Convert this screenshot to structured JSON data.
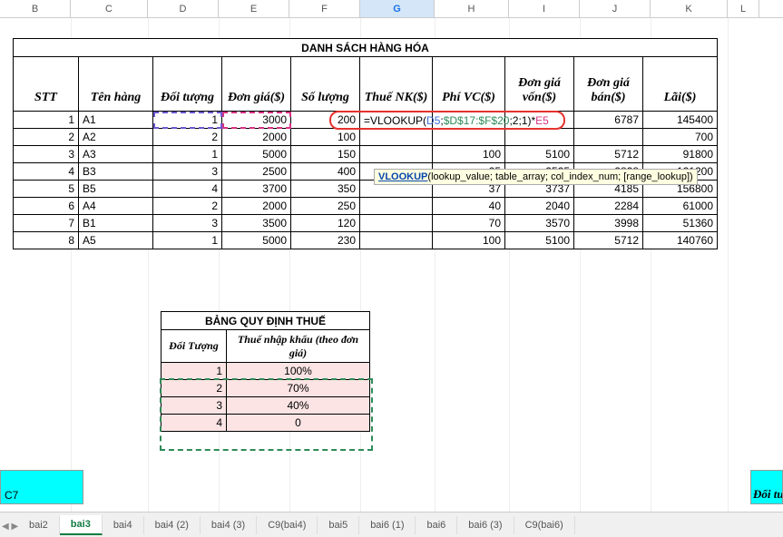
{
  "columns": [
    "B",
    "C",
    "D",
    "E",
    "F",
    "G",
    "H",
    "I",
    "J",
    "K",
    "L"
  ],
  "active_column": "G",
  "main": {
    "title": "DANH SÁCH HÀNG HÓA",
    "headers": [
      "STT",
      "Tên hàng",
      "Đối tượng",
      "Đơn giá($)",
      "Số lượng",
      "Thuế NK($)",
      "Phí VC($)",
      "Đơn giá vốn($)",
      "Đơn giá bán($)",
      "Lãi($)"
    ],
    "rows": [
      {
        "stt": "1",
        "ten": "A1",
        "dt": "1",
        "gia": "3000",
        "sl": "200",
        "thue": "=VLOOKUP(D5;$D$17:$F$20;2;1)*E5",
        "phi": "",
        "von": "",
        "ban": "6787",
        "lai": "145400"
      },
      {
        "stt": "2",
        "ten": "A2",
        "dt": "2",
        "gia": "2000",
        "sl": "100",
        "thue": "",
        "phi": "",
        "von": "",
        "ban": "",
        "lai": "700"
      },
      {
        "stt": "3",
        "ten": "A3",
        "dt": "1",
        "gia": "5000",
        "sl": "150",
        "thue": "",
        "phi": "100",
        "von": "5100",
        "ban": "5712",
        "lai": "91800"
      },
      {
        "stt": "4",
        "ten": "B3",
        "dt": "3",
        "gia": "2500",
        "sl": "400",
        "thue": "",
        "phi": "25",
        "von": "2525",
        "ban": "2828",
        "lai": "121200"
      },
      {
        "stt": "5",
        "ten": "B5",
        "dt": "4",
        "gia": "3700",
        "sl": "350",
        "thue": "",
        "phi": "37",
        "von": "3737",
        "ban": "4185",
        "lai": "156800"
      },
      {
        "stt": "6",
        "ten": "A4",
        "dt": "2",
        "gia": "2000",
        "sl": "250",
        "thue": "",
        "phi": "40",
        "von": "2040",
        "ban": "2284",
        "lai": "61000"
      },
      {
        "stt": "7",
        "ten": "B1",
        "dt": "3",
        "gia": "3500",
        "sl": "120",
        "thue": "",
        "phi": "70",
        "von": "3570",
        "ban": "3998",
        "lai": "51360"
      },
      {
        "stt": "8",
        "ten": "A5",
        "dt": "1",
        "gia": "5000",
        "sl": "230",
        "thue": "",
        "phi": "100",
        "von": "5100",
        "ban": "5712",
        "lai": "140760"
      }
    ]
  },
  "formula": {
    "prefix_num": "200",
    "text_eq": "=VLOOKUP(",
    "arg1": "D5",
    "sep1": ";",
    "arg2": "$D$17:$F$20",
    "sep2": ";2;1)*",
    "arg3": "E5"
  },
  "tooltip": {
    "fn": "VLOOKUP",
    "rest": "(lookup_value; table_array; col_index_num; [range_lookup])"
  },
  "tax": {
    "title": "BẢNG QUY ĐỊNH THUẾ",
    "h1": "Đối Tượng",
    "h2": "Thuế nhập khẩu (theo đơn giá)",
    "rows": [
      {
        "dt": "1",
        "rate": "100%"
      },
      {
        "dt": "2",
        "rate": "70%"
      },
      {
        "dt": "3",
        "rate": "40%"
      },
      {
        "dt": "4",
        "rate": "0"
      }
    ]
  },
  "cyan_left": "C7",
  "cyan_right": "Đối tư",
  "tabs": [
    "bai2",
    "bai3",
    "bai4",
    "bai4 (2)",
    "bai4 (3)",
    "C9(bai4)",
    "bai5",
    "bai6 (1)",
    "bai6",
    "bai6 (3)",
    "C9(bai6)"
  ],
  "active_tab": "bai3"
}
